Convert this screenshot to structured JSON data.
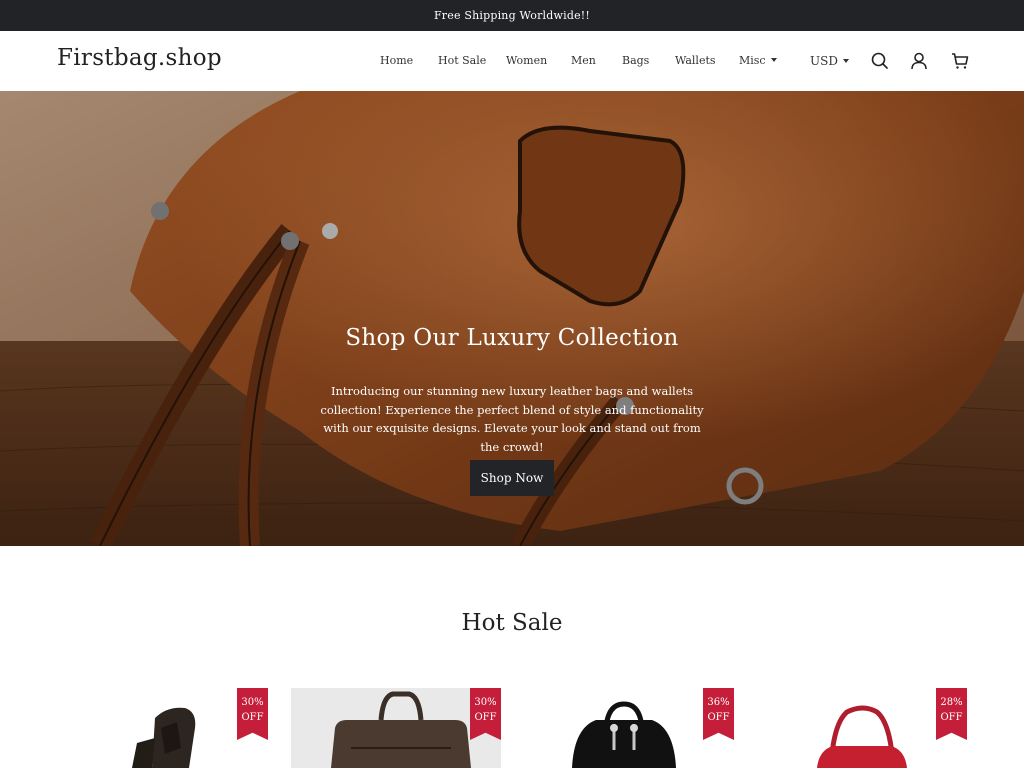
{
  "announcement": {
    "text": "Free Shipping Worldwide!!"
  },
  "header": {
    "logo": "Firstbag.shop",
    "nav": [
      {
        "label": "Home"
      },
      {
        "label": "Hot Sale"
      },
      {
        "label": "Women"
      },
      {
        "label": "Men"
      },
      {
        "label": "Bags"
      },
      {
        "label": "Wallets"
      },
      {
        "label": "Misc"
      }
    ],
    "currency": "USD",
    "icons": [
      "search-icon",
      "account-icon",
      "cart-icon"
    ]
  },
  "hero": {
    "title": "Shop Our Luxury Collection",
    "text": "Introducing our stunning new luxury leather bags and wallets collection! Experience the perfect blend of style and functionality with our exquisite designs. Elevate your look and stand out from the crowd!",
    "button": "Shop Now"
  },
  "section": {
    "title": "Hot Sale"
  },
  "products": [
    {
      "discount": "30%",
      "off": "OFF"
    },
    {
      "discount": "30%",
      "off": "OFF"
    },
    {
      "discount": "36%",
      "off": "OFF"
    },
    {
      "discount": "28%",
      "off": "OFF"
    }
  ],
  "colors": {
    "announcement_bg": "#212326",
    "button_bg": "#222428",
    "badge_red": "#c41e3a"
  }
}
